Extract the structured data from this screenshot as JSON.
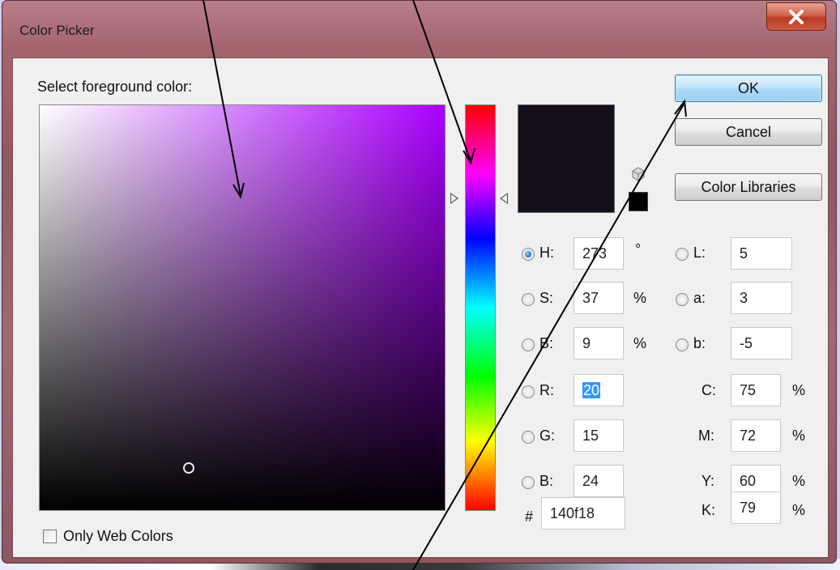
{
  "window": {
    "title": "Color Picker",
    "close_icon": "close-icon"
  },
  "prompt_label": "Select foreground color:",
  "buttons": {
    "ok": "OK",
    "cancel": "Cancel",
    "color_libraries": "Color Libraries"
  },
  "current_color_hex": "#140f18",
  "hsb": {
    "h": {
      "label": "H:",
      "value": "273",
      "unit": "°"
    },
    "s": {
      "label": "S:",
      "value": "37",
      "unit": "%"
    },
    "b": {
      "label": "B:",
      "value": "9",
      "unit": "%"
    }
  },
  "rgb": {
    "r": {
      "label": "R:",
      "value": "20"
    },
    "g": {
      "label": "G:",
      "value": "15"
    },
    "b": {
      "label": "B:",
      "value": "24"
    }
  },
  "lab": {
    "l": {
      "label": "L:",
      "value": "5"
    },
    "a": {
      "label": "a:",
      "value": "3"
    },
    "b": {
      "label": "b:",
      "value": "-5"
    }
  },
  "cmyk": {
    "c": {
      "label": "C:",
      "value": "75",
      "unit": "%"
    },
    "m": {
      "label": "M:",
      "value": "72",
      "unit": "%"
    },
    "y": {
      "label": "Y:",
      "value": "60",
      "unit": "%"
    },
    "k": {
      "label": "K:",
      "value": "79",
      "unit": "%"
    }
  },
  "hex": {
    "label": "#",
    "value": "140f18"
  },
  "only_web_colors": {
    "label": "Only Web Colors",
    "checked": false
  }
}
